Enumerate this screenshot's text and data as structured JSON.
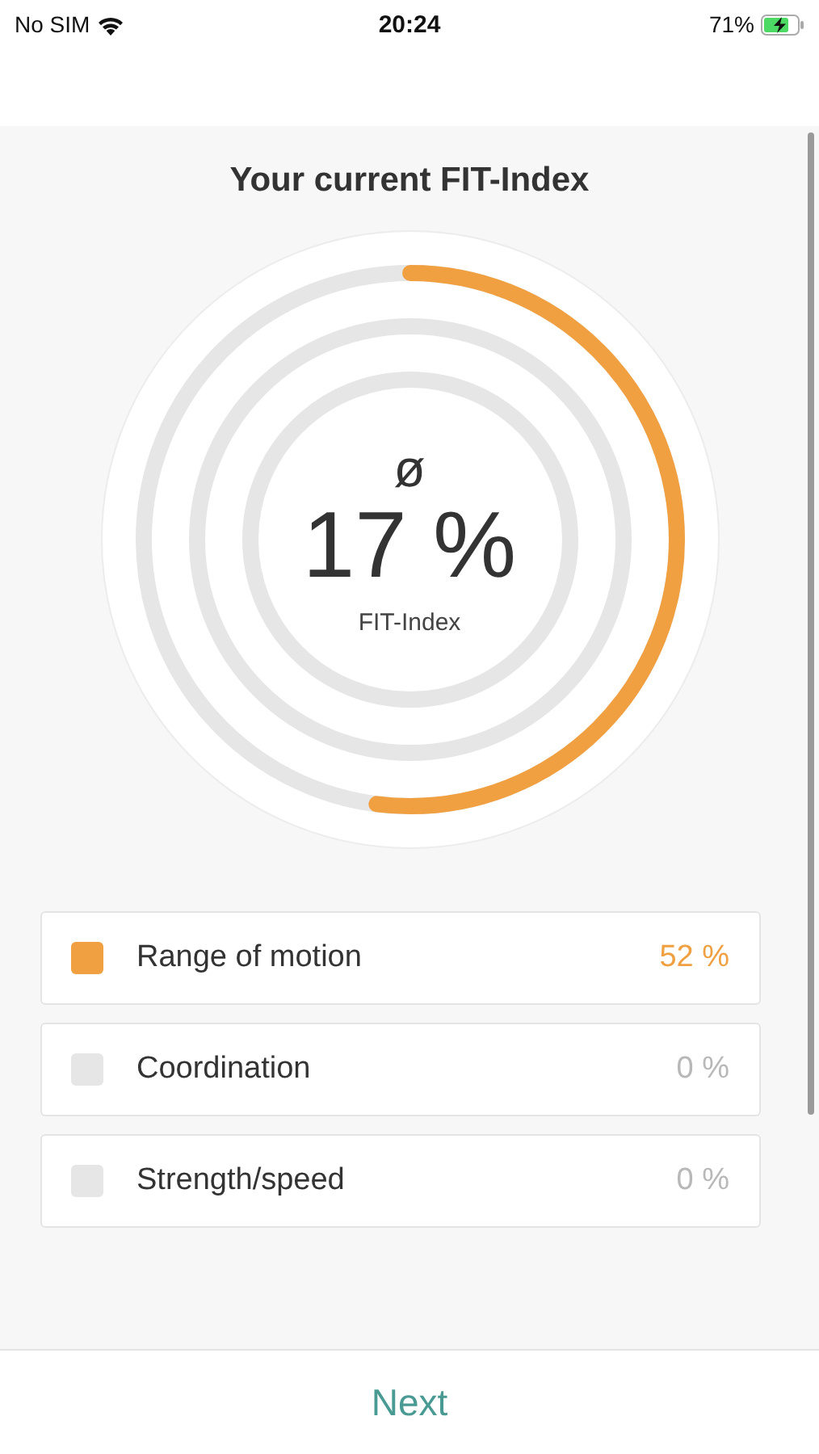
{
  "status_bar": {
    "carrier": "No SIM",
    "time": "20:24",
    "battery": "71%"
  },
  "title": "Your current FIT-Index",
  "gauge": {
    "symbol": "ø",
    "value": "17 %",
    "label": "FIT-Index"
  },
  "metrics": [
    {
      "name": "Range of motion",
      "reading": "52 %",
      "level": 0.52,
      "active": true
    },
    {
      "name": "Coordination",
      "reading": "0 %",
      "level": 0,
      "active": false
    },
    {
      "name": "Strength/speed",
      "reading": "0 %",
      "level": 0,
      "active": false
    }
  ],
  "next_button": "Next"
}
